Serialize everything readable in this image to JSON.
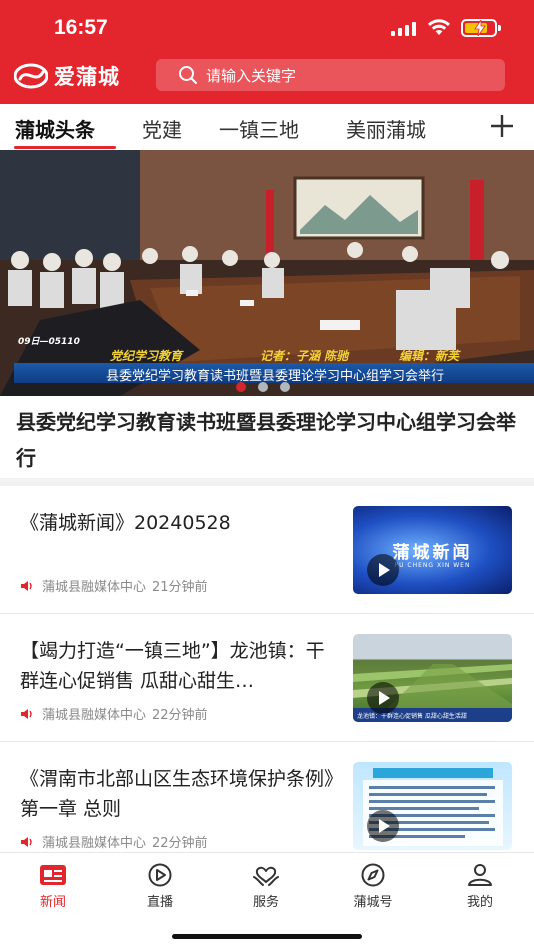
{
  "status_bar": {
    "time": "16:57"
  },
  "app": {
    "name": "爱蒲城",
    "brand_color": "#e3262d"
  },
  "search": {
    "placeholder": "请输入关键字"
  },
  "tabs": [
    {
      "label": "蒲城头条",
      "active": true
    },
    {
      "label": "党建",
      "active": false
    },
    {
      "label": "一镇三地",
      "active": false
    },
    {
      "label": "美丽蒲城",
      "active": false
    }
  ],
  "banner": {
    "caption_program": "党纪学习教育",
    "caption_reporter": "记者：子涵  陈驰",
    "caption_editor": "编辑：新芙",
    "caption_line": "县委党纪学习教育读书班暨县委理论学习中心组学习会举行",
    "caption_date": "09日—05110",
    "headline": "县委党纪学习教育读书班暨县委理论学习中心组学习会举行",
    "active_slide": 1,
    "slide_count": 3
  },
  "news": [
    {
      "title": "《蒲城新闻》20240528",
      "source": "蒲城县融媒体中心",
      "time": "21分钟前",
      "thumb_text": "蒲城新闻",
      "thumb_sub": "PU CHENG XIN WEN"
    },
    {
      "title": "【竭力打造“一镇三地”】龙池镇：干群连心促销售 瓜甜心甜生…",
      "source": "蒲城县融媒体中心",
      "time": "22分钟前",
      "thumb_caption": "龙池镇：干群连心促销售 瓜甜心甜生活甜"
    },
    {
      "title": "《渭南市北部山区生态环境保护条例》第一章 总则",
      "source": "蒲城县融媒体中心",
      "time": "22分钟前"
    }
  ],
  "bottom_nav": [
    {
      "label": "新闻",
      "icon": "news-icon",
      "active": true
    },
    {
      "label": "直播",
      "icon": "live-play-icon",
      "active": false
    },
    {
      "label": "服务",
      "icon": "service-heart-icon",
      "active": false
    },
    {
      "label": "蒲城号",
      "icon": "compass-icon",
      "active": false
    },
    {
      "label": "我的",
      "icon": "profile-icon",
      "active": false
    }
  ]
}
